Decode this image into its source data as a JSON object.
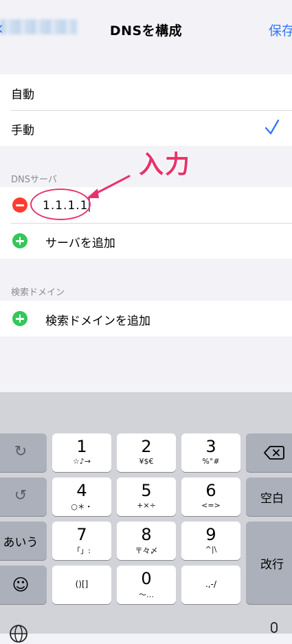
{
  "nav": {
    "back_label": "",
    "title": "DNSを構成",
    "save_label": "保存"
  },
  "mode_options": [
    {
      "label": "自動",
      "selected": false
    },
    {
      "label": "手動",
      "selected": true
    }
  ],
  "dns_section": {
    "header": "DNSサーバ",
    "server_value": "1.1.1.1",
    "add_label": "サーバを追加"
  },
  "search_section": {
    "header": "検索ドメイン",
    "add_label": "検索ドメインを追加"
  },
  "annotation": {
    "text": "入力",
    "color": "#e8336a"
  },
  "keyboard": {
    "left_keys": [
      "undo-icon",
      "redo-icon",
      "あいう",
      "emoji-icon"
    ],
    "digits": [
      {
        "main": "1",
        "sub": "☆♪→"
      },
      {
        "main": "2",
        "sub": "¥$€"
      },
      {
        "main": "3",
        "sub": "%°#"
      },
      {
        "main": "4",
        "sub": "○＊・"
      },
      {
        "main": "5",
        "sub": "+×÷"
      },
      {
        "main": "6",
        "sub": "<=>"
      },
      {
        "main": "7",
        "sub": "「」:"
      },
      {
        "main": "8",
        "sub": "〒々〆"
      },
      {
        "main": "9",
        "sub": "^|\\"
      },
      {
        "main": "0",
        "sub": "〜…"
      }
    ],
    "paren_key": "()[]",
    "punct_key": ".,-/",
    "space_label": "空白",
    "return_label": "改行"
  },
  "colors": {
    "accent": "#3478f6",
    "minus": "#ff3b30",
    "plus": "#34c759"
  }
}
